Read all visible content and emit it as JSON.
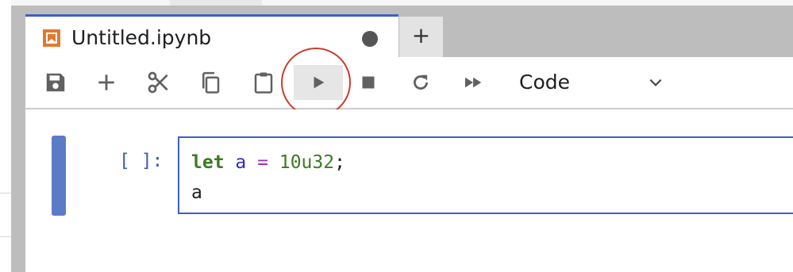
{
  "tab": {
    "title": "Untitled.ipynb",
    "new_tab_label": "+"
  },
  "toolbar": {
    "buttons": [
      {
        "name": "save-icon"
      },
      {
        "name": "add-cell-icon"
      },
      {
        "name": "cut-icon"
      },
      {
        "name": "copy-icon"
      },
      {
        "name": "paste-icon"
      },
      {
        "name": "run-icon",
        "highlighted": true
      },
      {
        "name": "stop-icon"
      },
      {
        "name": "restart-icon"
      },
      {
        "name": "run-all-icon"
      }
    ],
    "cell_type": "Code"
  },
  "cell": {
    "prompt": "[ ]:",
    "code_lines": [
      [
        {
          "text": "let",
          "kind": "keyword"
        },
        {
          "text": " ",
          "kind": "plain"
        },
        {
          "text": "a",
          "kind": "variable"
        },
        {
          "text": " ",
          "kind": "plain"
        },
        {
          "text": "=",
          "kind": "operator"
        },
        {
          "text": " ",
          "kind": "plain"
        },
        {
          "text": "10u32",
          "kind": "number"
        },
        {
          "text": ";",
          "kind": "plain"
        }
      ],
      [
        {
          "text": "a",
          "kind": "plain"
        }
      ]
    ]
  },
  "colors": {
    "accent": "#3f5fc6",
    "annotation_circle": "#cc3b2a",
    "collapser": "#5c7bc6",
    "keyword": "#3b7a23",
    "variable": "#2c2cc8",
    "operator": "#a431c4"
  }
}
